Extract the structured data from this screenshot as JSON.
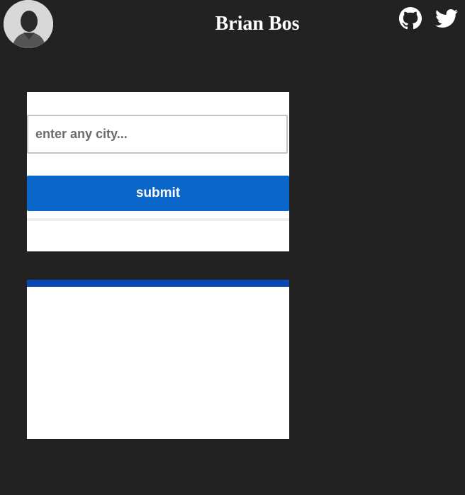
{
  "header": {
    "title": "Brian Bos",
    "avatar_icon": "user-avatar-photo",
    "links": [
      {
        "icon": "github-icon"
      },
      {
        "icon": "twitter-icon"
      }
    ]
  },
  "form": {
    "city_placeholder": "enter any city...",
    "city_value": "",
    "submit_label": "submit"
  },
  "colors": {
    "background": "#222222",
    "accent": "#0a66c8",
    "result_header": "#0a47b3"
  }
}
